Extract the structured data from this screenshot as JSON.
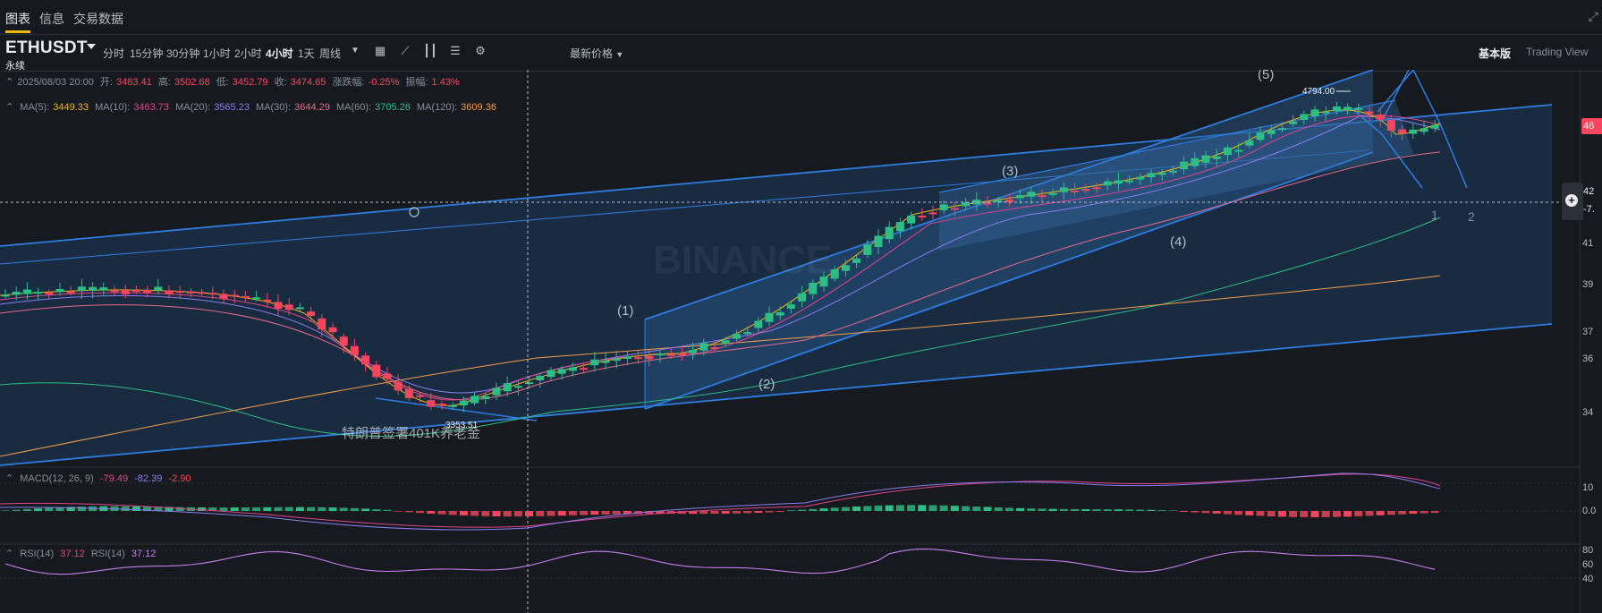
{
  "tabs": [
    "图表",
    "信息",
    "交易数据"
  ],
  "toolbar": {
    "symbol": "ETHUSDT",
    "symbol_sub": "永续",
    "intervals": [
      "分时",
      "15分钟",
      "30分钟",
      "1小时",
      "2小时",
      "4小时",
      "1天",
      "周线"
    ],
    "active_interval": "4小时",
    "latest_price_label": "最新价格",
    "view_basic": "基本版",
    "view_tradingview": "Trading View",
    "icons": [
      "calendar-icon",
      "indicator-icon",
      "candle-type-icon",
      "layout-icon",
      "settings-icon"
    ]
  },
  "ohlc": {
    "datetime": "2025/08/03 20:00",
    "open_label": "开:",
    "open": "3483.41",
    "high_label": "高:",
    "high": "3502.68",
    "low_label": "低:",
    "low": "3452.79",
    "close_label": "收:",
    "close": "3474.65",
    "change_label": "涨跌幅:",
    "change": "-0.25%",
    "amplitude_label": "振幅:",
    "amplitude": "1.43%"
  },
  "ma": {
    "ma5_label": "MA(5):",
    "ma5": "3449.33",
    "ma10_label": "MA(10):",
    "ma10": "3463.73",
    "ma20_label": "MA(20):",
    "ma20": "3565.23",
    "ma30_label": "MA(30):",
    "ma30": "3644.29",
    "ma60_label": "MA(60):",
    "ma60": "3705.26",
    "ma120_label": "MA(120):",
    "ma120": "3609.36"
  },
  "macd": {
    "label": "MACD(12, 26, 9)",
    "dif": "-79.49",
    "dea": "-82.39",
    "hist": "-2.90"
  },
  "rsi": {
    "label": "RSI(14)",
    "value": "37.12",
    "label2": "RSI(14)",
    "value2": "37.12"
  },
  "annotations": {
    "wave1": "(1)",
    "wave2": "(2)",
    "wave3": "(3)",
    "wave4": "(4)",
    "wave5": "(5)",
    "target1": "1",
    "target2": "2",
    "high_label": "4794.00",
    "low_label": "3353.51",
    "watermark": "BINANCE",
    "event_note": "特朗普签署401K养老金"
  },
  "price_axis": {
    "current_price_flag": "46",
    "cross_price": "42",
    "cross_change": "-7.",
    "ticks": [
      "41",
      "39",
      "37",
      "36",
      "34"
    ],
    "macd_ticks": [
      "10",
      "0.0"
    ],
    "rsi_ticks": [
      "80",
      "60",
      "40"
    ]
  },
  "colors": {
    "up": "#2ebd85",
    "down": "#f6465d",
    "channel": "#2f7de1",
    "background": "#161a1e",
    "accent": "#f0b90b"
  }
}
